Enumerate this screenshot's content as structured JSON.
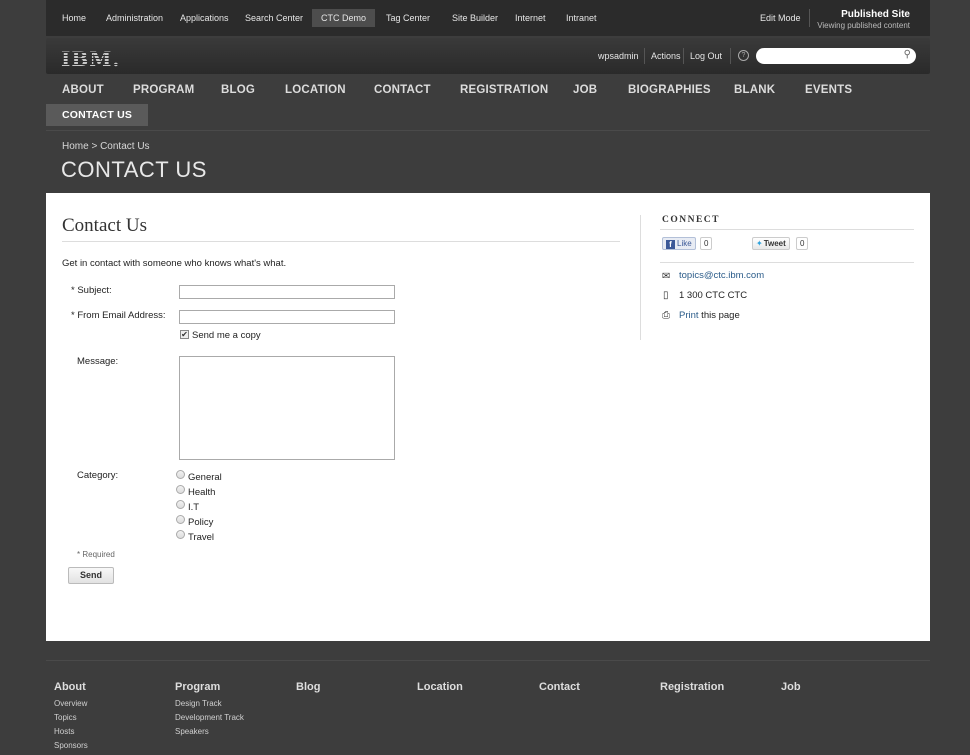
{
  "topbar": {
    "links": [
      "Home",
      "Administration",
      "Applications",
      "Search Center",
      "CTC Demo",
      "Tag Center",
      "Site Builder",
      "Internet",
      "Intranet"
    ],
    "edit_mode": "Edit Mode",
    "published_title": "Published Site",
    "published_sub": "Viewing published content"
  },
  "header": {
    "logo": "IBM.",
    "user": "wpsadmin",
    "actions": "Actions",
    "logout": "Log Out",
    "help_glyph": "?",
    "search_placeholder": ""
  },
  "nav": {
    "items": [
      "ABOUT",
      "PROGRAM",
      "BLOG",
      "LOCATION",
      "CONTACT",
      "REGISTRATION",
      "JOB",
      "BIOGRAPHIES",
      "BLANK",
      "EVENTS"
    ],
    "active": "CONTACT US"
  },
  "breadcrumb": "Home > Contact Us",
  "page_title": "CONTACT US",
  "form": {
    "heading": "Contact Us",
    "intro": "Get in contact with someone who knows what's what.",
    "subject_label": "* Subject:",
    "email_label": "* From Email Address:",
    "copy_label": "Send me a copy",
    "message_label": "Message:",
    "category_label": "Category:",
    "categories": [
      "General",
      "Health",
      "I.T",
      "Policy",
      "Travel"
    ],
    "required_note": "* Required",
    "send": "Send"
  },
  "connect": {
    "heading": "CONNECT",
    "like": "Like",
    "like_count": "0",
    "tweet": "Tweet",
    "tweet_count": "0",
    "email": "topics@ctc.ibm.com",
    "phone": "1 300 CTC CTC",
    "print_link": "Print",
    "print_rest": " this page"
  },
  "footer": {
    "columns": [
      {
        "title": "About",
        "links": [
          "Overview",
          "Topics",
          "Hosts",
          "Sponsors"
        ]
      },
      {
        "title": "Program",
        "links": [
          "Design Track",
          "Development Track",
          "Speakers"
        ]
      },
      {
        "title": "Blog",
        "links": []
      },
      {
        "title": "Location",
        "links": []
      },
      {
        "title": "Contact",
        "links": []
      },
      {
        "title": "Registration",
        "links": []
      },
      {
        "title": "Job",
        "links": []
      }
    ]
  },
  "colors": {
    "page_bg": "#3d3d3d",
    "panel_bg": "#ffffff",
    "link": "#2b5c8a",
    "facebook": "#3b5998",
    "twitter": "#2ea2dc"
  }
}
